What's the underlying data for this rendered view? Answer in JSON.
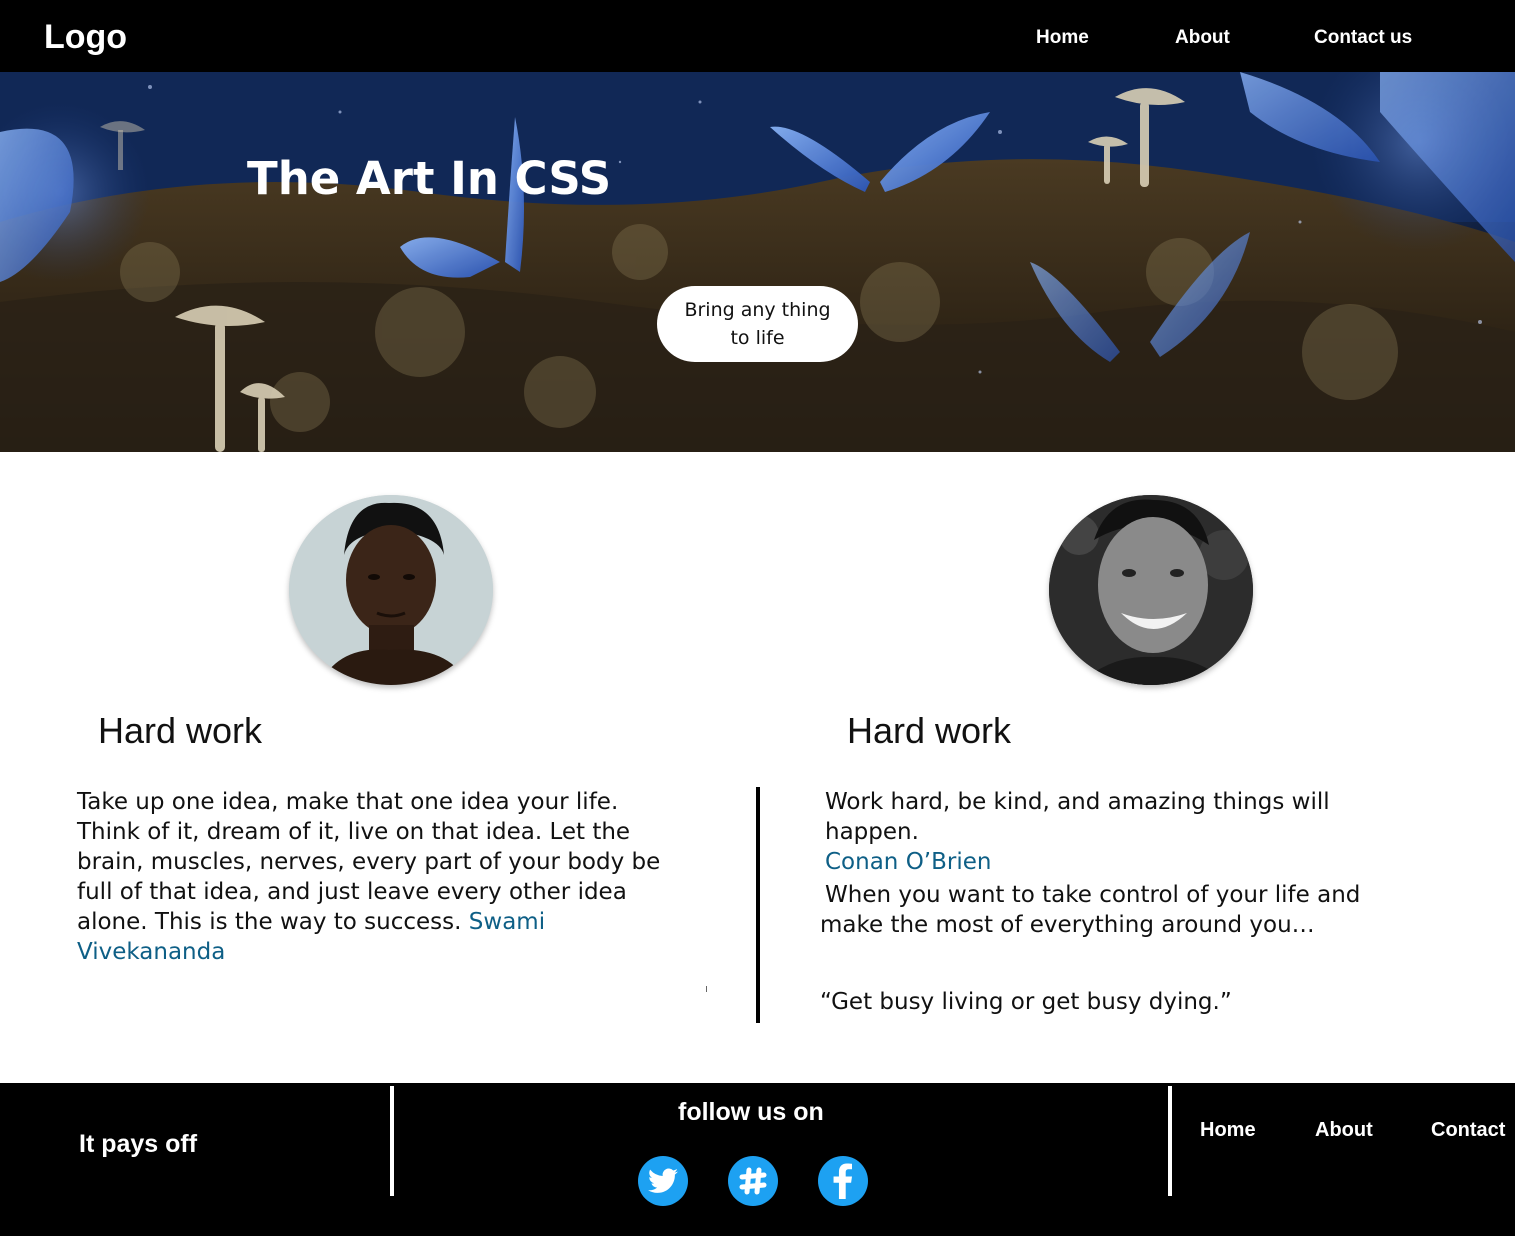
{
  "header": {
    "logo": "Logo",
    "nav": [
      {
        "label": "Home"
      },
      {
        "label": "About"
      },
      {
        "label": "Contact us"
      }
    ]
  },
  "hero": {
    "title": "The Art In CSS",
    "button_label": "Bring any thing to life"
  },
  "cards": [
    {
      "heading": "Hard work",
      "quote": "Take up one idea, make that one idea your life. Think of it, dream of it, live on that idea. Let the brain, muscles, nerves, every part of your body be full of that idea, and just leave every other idea alone. This is the way to success.",
      "author": "Swami Vivekananda"
    },
    {
      "heading": "Hard work",
      "quote": "Work hard, be kind, and amazing things will happen.",
      "author": "Conan O’Brien",
      "quote2": "When you want to take control of your life and make the most of everything around you…",
      "quote3": "“Get busy living or get busy dying.”"
    }
  ],
  "footer": {
    "tagline": "It pays off",
    "follow_label": "follow us on",
    "socials": [
      {
        "icon": "twitter-icon"
      },
      {
        "icon": "slack-icon"
      },
      {
        "icon": "facebook-icon"
      }
    ],
    "links": [
      {
        "label": "Home"
      },
      {
        "label": "About"
      },
      {
        "label": "Contact"
      }
    ]
  },
  "colors": {
    "bar": "#000000",
    "author_link": "#0e5f86",
    "social_blue": "#1da1f2"
  }
}
